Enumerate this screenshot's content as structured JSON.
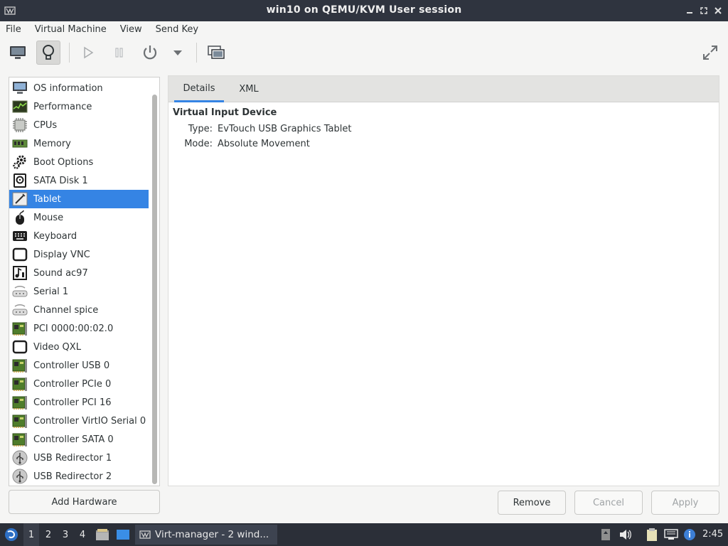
{
  "window": {
    "title": "win10 on QEMU/KVM User session"
  },
  "menu": [
    "File",
    "Virtual Machine",
    "View",
    "Send Key"
  ],
  "toolbar": {
    "buttons": [
      "monitor-icon",
      "lightbulb-icon",
      "play-icon",
      "pause-icon",
      "power-icon",
      "dropdown-icon",
      "snapshot-icon",
      "fullscreen-icon"
    ]
  },
  "hardware_list": [
    {
      "label": "OS information",
      "icon": "monitor-icon"
    },
    {
      "label": "Performance",
      "icon": "performance-icon"
    },
    {
      "label": "CPUs",
      "icon": "cpu-icon"
    },
    {
      "label": "Memory",
      "icon": "memory-icon"
    },
    {
      "label": "Boot Options",
      "icon": "gears-icon"
    },
    {
      "label": "SATA Disk 1",
      "icon": "disk-icon"
    },
    {
      "label": "Tablet",
      "icon": "tablet-icon",
      "selected": true
    },
    {
      "label": "Mouse",
      "icon": "mouse-icon"
    },
    {
      "label": "Keyboard",
      "icon": "keyboard-icon"
    },
    {
      "label": "Display VNC",
      "icon": "display-icon"
    },
    {
      "label": "Sound ac97",
      "icon": "sound-icon"
    },
    {
      "label": "Serial 1",
      "icon": "serial-icon"
    },
    {
      "label": "Channel spice",
      "icon": "serial-icon"
    },
    {
      "label": "PCI 0000:00:02.0",
      "icon": "pci-card-icon"
    },
    {
      "label": "Video QXL",
      "icon": "display-icon"
    },
    {
      "label": "Controller USB 0",
      "icon": "pci-card-icon"
    },
    {
      "label": "Controller PCIe 0",
      "icon": "pci-card-icon"
    },
    {
      "label": "Controller PCI 16",
      "icon": "pci-card-icon"
    },
    {
      "label": "Controller VirtIO Serial 0",
      "icon": "pci-card-icon"
    },
    {
      "label": "Controller SATA 0",
      "icon": "pci-card-icon"
    },
    {
      "label": "USB Redirector 1",
      "icon": "usb-redirector-icon"
    },
    {
      "label": "USB Redirector 2",
      "icon": "usb-redirector-icon"
    }
  ],
  "tabs": [
    "Details",
    "XML"
  ],
  "details": {
    "section_title": "Virtual Input Device",
    "type_label": "Type:",
    "type_value": "EvTouch USB Graphics Tablet",
    "mode_label": "Mode:",
    "mode_value": "Absolute Movement"
  },
  "buttons": {
    "add_hardware": "Add Hardware",
    "remove": "Remove",
    "cancel": "Cancel",
    "apply": "Apply"
  },
  "taskbar": {
    "workspaces": [
      "1",
      "2",
      "3",
      "4"
    ],
    "task_label": "Virt-manager - 2 wind...",
    "clock": "2:45"
  },
  "colors": {
    "accent": "#3584e4",
    "titlebar": "#2f343f",
    "taskbar": "#2b2f38"
  }
}
